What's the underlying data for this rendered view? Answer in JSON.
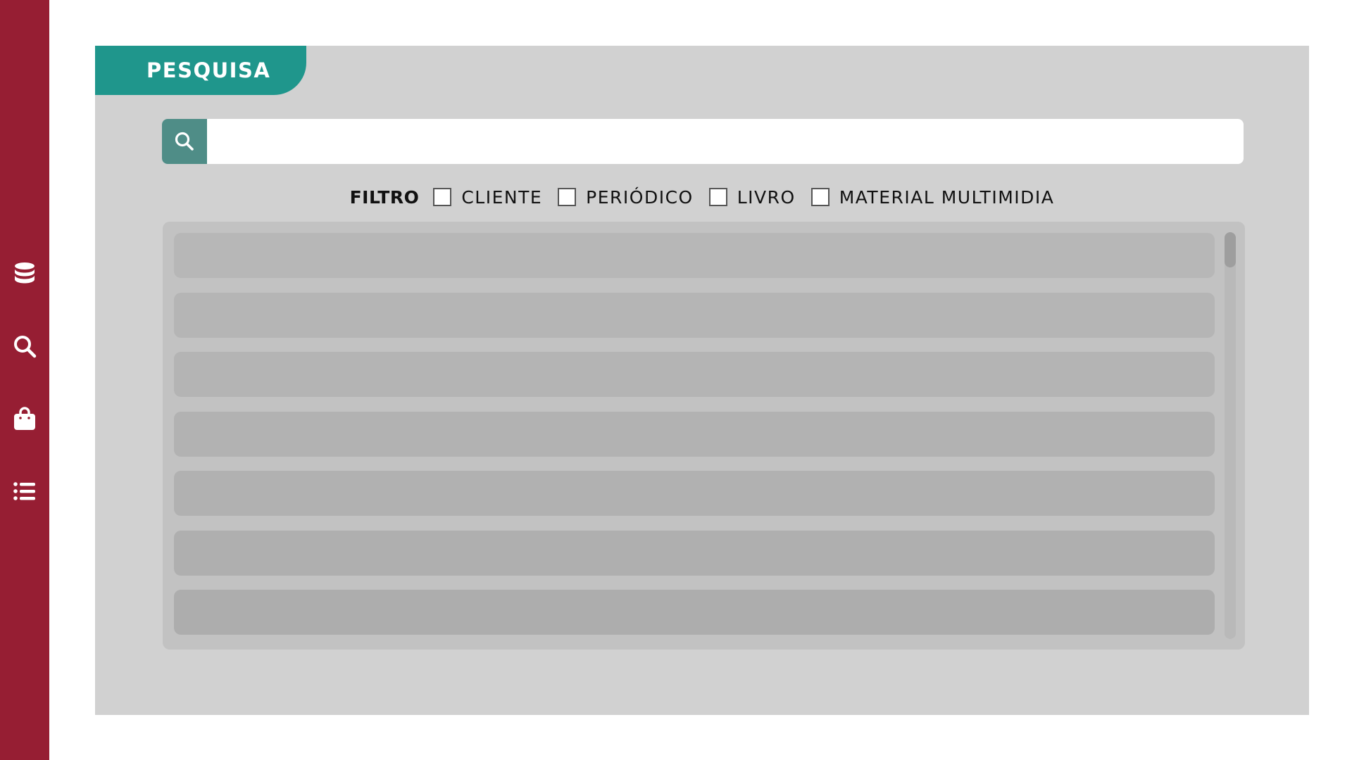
{
  "sidebar": {
    "icons": [
      "database-icon",
      "search-icon",
      "shopping-bag-icon",
      "list-icon"
    ]
  },
  "panel": {
    "tab_label": "PESQUISA"
  },
  "search": {
    "value": "",
    "placeholder": ""
  },
  "filters": {
    "label": "FILTRO",
    "options": [
      {
        "label": "CLIENTE",
        "checked": false
      },
      {
        "label": "PERIÓDICO",
        "checked": false
      },
      {
        "label": "LIVRO",
        "checked": false
      },
      {
        "label": "MATERIAL MULTIMIDIA",
        "checked": false
      }
    ]
  },
  "results": {
    "row_count": 7,
    "row_colors": [
      "#b7b7b7",
      "#b5b5b5",
      "#b4b4b4",
      "#b2b2b2",
      "#b1b1b1",
      "#afafaf",
      "#adadad"
    ]
  },
  "colors": {
    "sidebar": "#961e33",
    "tab": "#1f968c",
    "search_button": "#4f8d87",
    "panel": "#d1d1d1"
  }
}
